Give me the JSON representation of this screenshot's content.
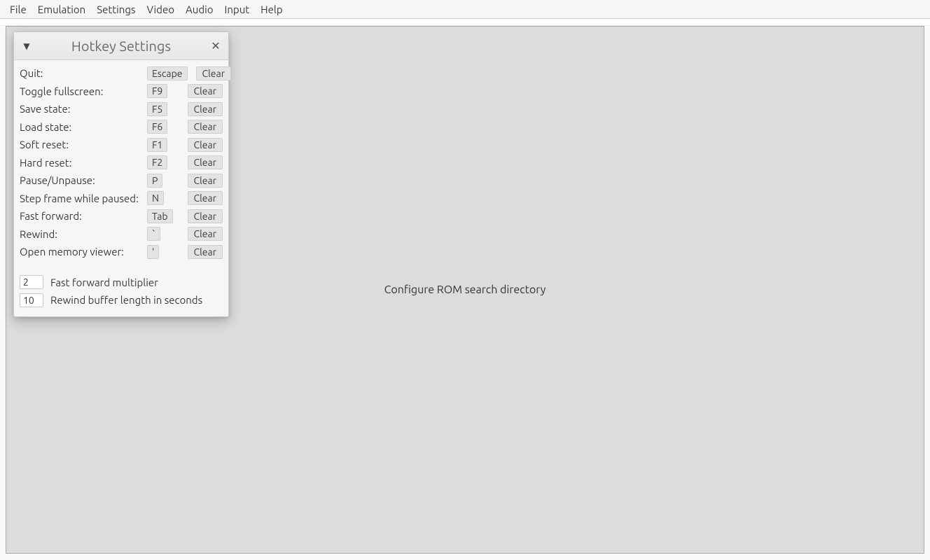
{
  "menubar": {
    "items": [
      "File",
      "Emulation",
      "Settings",
      "Video",
      "Audio",
      "Input",
      "Help"
    ]
  },
  "viewport": {
    "message": "Configure ROM search directory"
  },
  "panel": {
    "title": "Hotkey Settings",
    "clear_label": "Clear",
    "hotkeys": [
      {
        "label": "Quit:",
        "key": "Escape"
      },
      {
        "label": "Toggle fullscreen:",
        "key": "F9"
      },
      {
        "label": "Save state:",
        "key": "F5"
      },
      {
        "label": "Load state:",
        "key": "F6"
      },
      {
        "label": "Soft reset:",
        "key": "F1"
      },
      {
        "label": "Hard reset:",
        "key": "F2"
      },
      {
        "label": "Pause/Unpause:",
        "key": "P"
      },
      {
        "label": "Step frame while paused:",
        "key": "N"
      },
      {
        "label": "Fast forward:",
        "key": "Tab"
      },
      {
        "label": "Rewind:",
        "key": "`"
      },
      {
        "label": "Open memory viewer:",
        "key": "'"
      }
    ],
    "numeric": [
      {
        "value": "2",
        "label": "Fast forward multiplier"
      },
      {
        "value": "10",
        "label": "Rewind buffer length in seconds"
      }
    ]
  }
}
